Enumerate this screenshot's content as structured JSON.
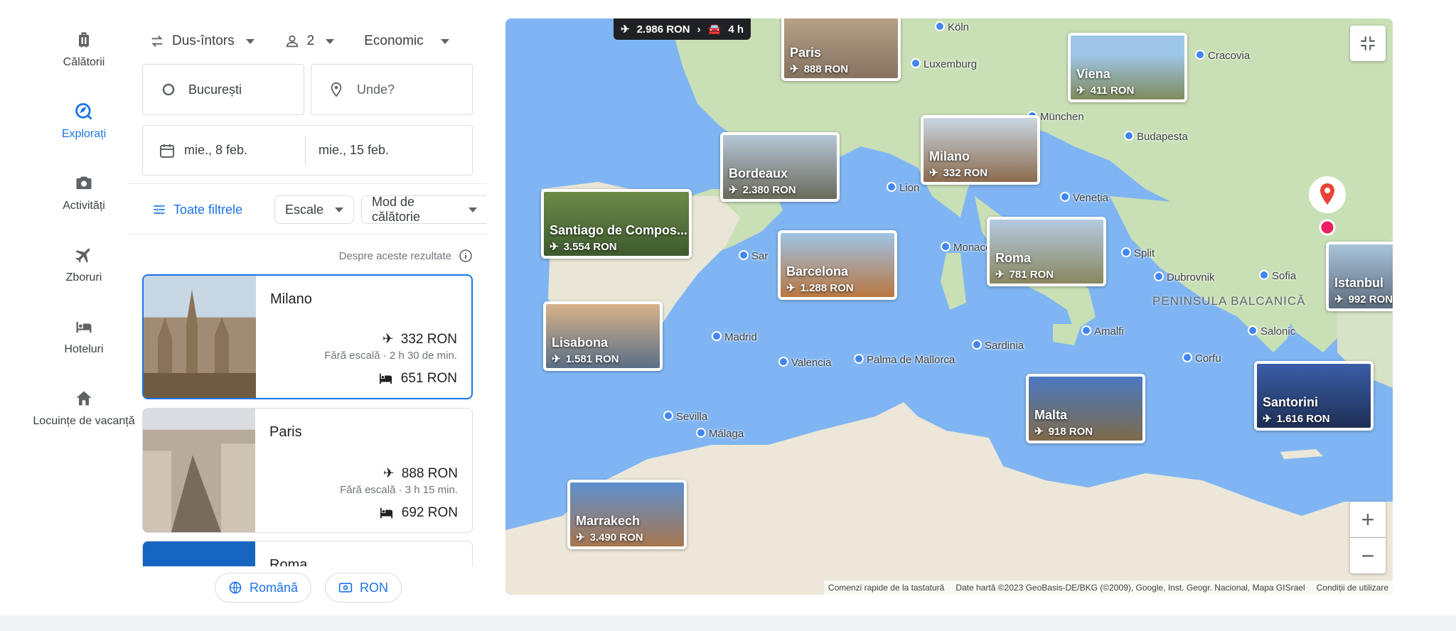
{
  "rail": {
    "items": [
      {
        "label": "Călătorii",
        "icon": "luggage-icon"
      },
      {
        "label": "Explorați",
        "icon": "explore-icon"
      },
      {
        "label": "Activități",
        "icon": "camera-icon"
      },
      {
        "label": "Zboruri",
        "icon": "flight-icon"
      },
      {
        "label": "Hoteluri",
        "icon": "hotel-icon"
      },
      {
        "label": "Locuințe de vacanță",
        "icon": "home-icon"
      }
    ]
  },
  "search": {
    "trip_type": "Dus-întors",
    "passengers": "2",
    "cabin": "Economic",
    "origin": "București",
    "destination_placeholder": "Unde?",
    "depart_date": "mie., 8 feb.",
    "return_date": "mie., 15 feb."
  },
  "filters": {
    "all_filters": "Toate filtrele",
    "stops": "Escale",
    "travel_mode": "Mod de călătorie"
  },
  "about_results": "Despre aceste rezultate",
  "results": [
    {
      "city": "Milano",
      "flight_price": "332 RON",
      "flight_meta": "Fără escală · 2 h 30 de min.",
      "hotel_price": "651 RON"
    },
    {
      "city": "Paris",
      "flight_price": "888 RON",
      "flight_meta": "Fără escală · 3 h 15 min.",
      "hotel_price": "692 RON"
    },
    {
      "city": "Roma"
    }
  ],
  "footer": {
    "language": "Română",
    "currency": "RON"
  },
  "map": {
    "top_badge": {
      "price": "2.986 RON",
      "duration": "4 h"
    },
    "pins": [
      {
        "name": "Paris",
        "price": "888 RON"
      },
      {
        "name": "Viena",
        "price": "411 RON"
      },
      {
        "name": "Milano",
        "price": "332 RON"
      },
      {
        "name": "Bordeaux",
        "price": "2.380 RON"
      },
      {
        "name": "Santiago de Compos...",
        "price": "3.554 RON"
      },
      {
        "name": "Barcelona",
        "price": "1.288 RON"
      },
      {
        "name": "Roma",
        "price": "781 RON"
      },
      {
        "name": "Istanbul",
        "price": "992 RON"
      },
      {
        "name": "Lisabona",
        "price": "1.581 RON"
      },
      {
        "name": "Malta",
        "price": "918 RON"
      },
      {
        "name": "Santorini",
        "price": "1.616 RON"
      },
      {
        "name": "Marrakech",
        "price": "3.490 RON"
      }
    ],
    "places": [
      "Köln",
      "Luxemburg",
      "Cracovia",
      "München",
      "Budapesta",
      "Lion",
      "Veneția",
      "Monaco",
      "Split",
      "Dubrovnik",
      "Sofia",
      "Sar",
      "Madrid",
      "Valencia",
      "Palma de Mallorca",
      "Sardinia",
      "Amalfi",
      "Salonic",
      "Corfu",
      "Sevilla",
      "Málaga"
    ],
    "region": "PENINSULA BALCANICĂ",
    "attribution": [
      "Comenzi rapide de la tastatură",
      "Date hartă ©2023 GeoBasis-DE/BKG (©2009), Google, Inst. Geogr. Nacional, Mapa GISrael",
      "Condiții de utilizare"
    ],
    "zoom_in": "+",
    "zoom_out": "−"
  }
}
